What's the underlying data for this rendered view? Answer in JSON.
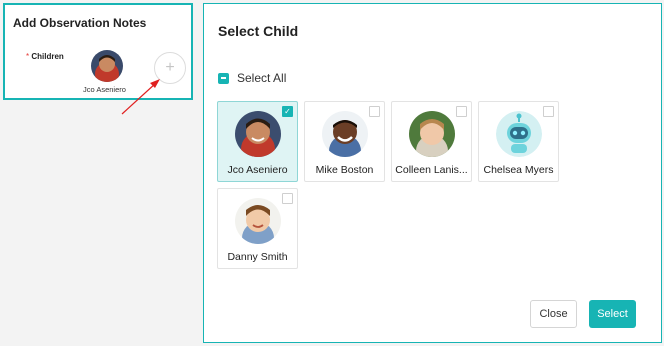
{
  "left_panel": {
    "title": "Add Observation Notes",
    "required_mark": "*",
    "children_label": "Children",
    "selected_child_name": "Jco Aseniero",
    "add_icon": "plus-icon",
    "add_glyph": "+"
  },
  "modal": {
    "title": "Select Child",
    "select_all_label": "Select All",
    "select_all_state": "indeterminate",
    "children": [
      {
        "name": "Jco Aseniero",
        "selected": true,
        "avatar": "photo"
      },
      {
        "name": "Mike Boston",
        "selected": false,
        "avatar": "photo"
      },
      {
        "name": "Colleen Lanis...",
        "selected": false,
        "avatar": "photo"
      },
      {
        "name": "Chelsea Myers",
        "selected": false,
        "avatar": "default-robot-avatar"
      },
      {
        "name": "Danny Smith",
        "selected": false,
        "avatar": "photo"
      }
    ],
    "close_label": "Close",
    "select_label": "Select"
  },
  "colors": {
    "accent": "#17b4b4",
    "selected_card_bg": "#dff4f4",
    "annotation_arrow": "#e02020",
    "required_star": "#e53935"
  }
}
